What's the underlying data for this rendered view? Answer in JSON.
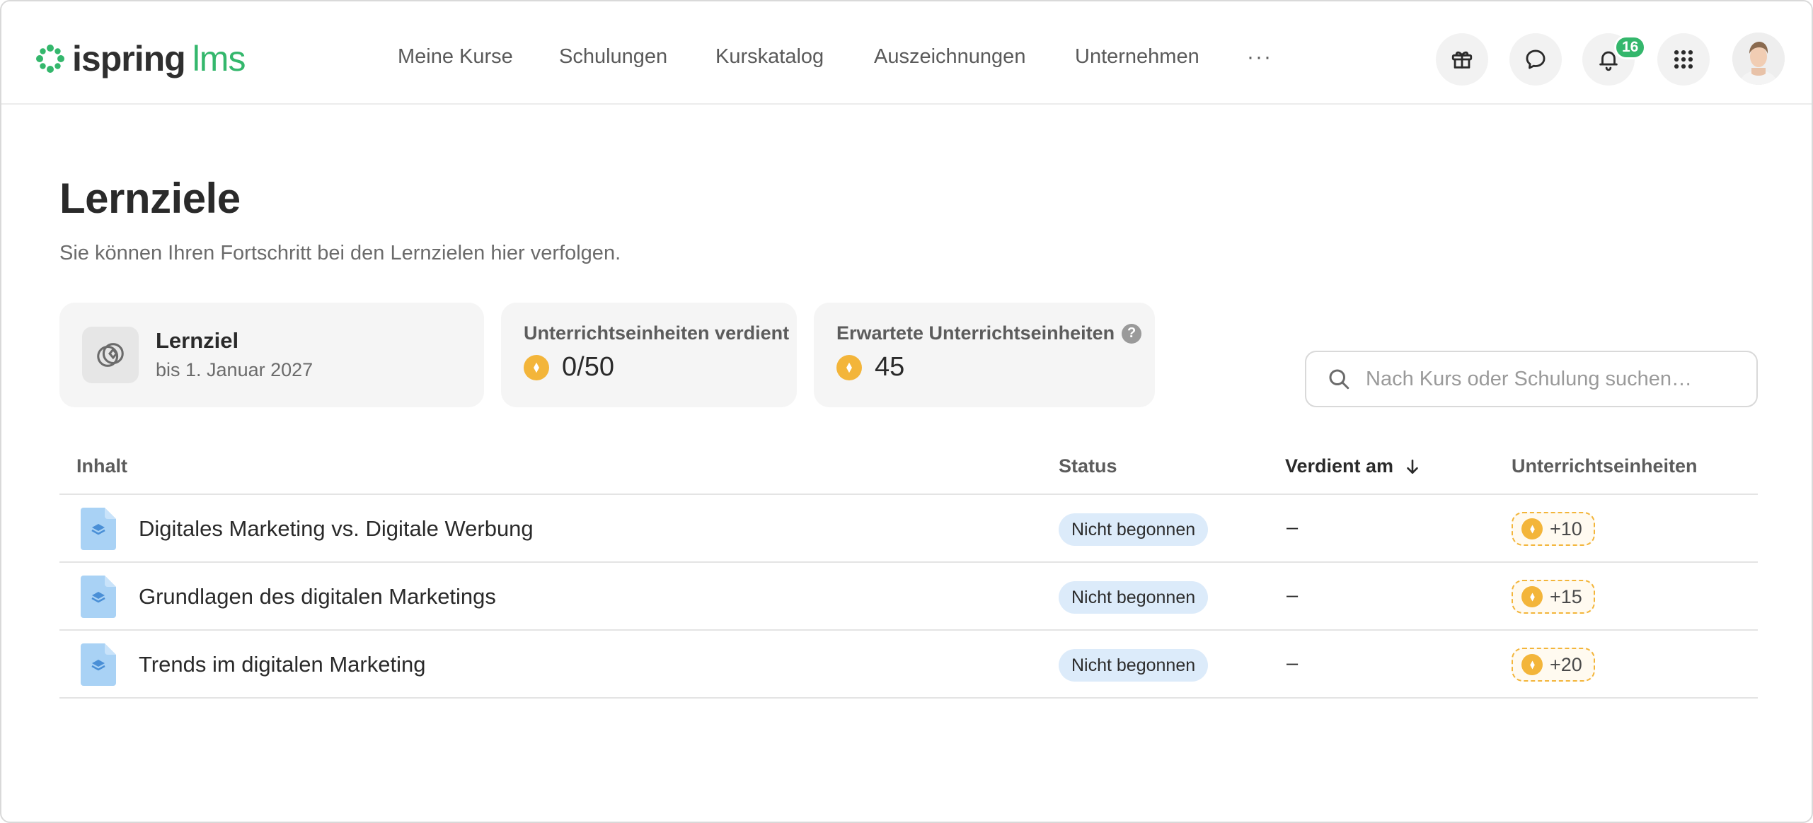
{
  "app": {
    "logo_word1": "ispring",
    "logo_word2": "lms",
    "brand_color": "#34b76c"
  },
  "nav": {
    "items": [
      {
        "label": "Meine Kurse"
      },
      {
        "label": "Schulungen"
      },
      {
        "label": "Kurskatalog"
      },
      {
        "label": "Auszeichnungen"
      },
      {
        "label": "Unternehmen"
      }
    ],
    "more_label": "···"
  },
  "header_actions": {
    "icons": [
      "gift-icon",
      "chat-icon",
      "bell-icon",
      "apps-grid-icon"
    ],
    "notification_count": "16"
  },
  "page": {
    "title": "Lernziele",
    "subtitle": "Sie können Ihren Fortschritt bei den Lernzielen hier verfolgen."
  },
  "summary": {
    "goal": {
      "title": "Lernziel",
      "date": "bis 1. Januar 2027"
    },
    "earned": {
      "label": "Unterrichtseinheiten verdient",
      "value": "0/50"
    },
    "expected": {
      "label": "Erwartete Unterrichtseinheiten",
      "help": "?",
      "value": "45"
    },
    "coin_color": "#f3b53a"
  },
  "search": {
    "placeholder": "Nach Kurs oder Schulung suchen…",
    "value": ""
  },
  "table": {
    "columns": {
      "content": "Inhalt",
      "status": "Status",
      "earned_on": "Verdient am",
      "units": "Unterrichtseinheiten"
    },
    "sort": {
      "column": "earned_on",
      "direction": "descending"
    },
    "rows": [
      {
        "title": "Digitales Marketing vs. Digitale Werbung",
        "status": "Nicht begonnen",
        "earned_on": "–",
        "units": "+10"
      },
      {
        "title": "Grundlagen des digitalen Marketings",
        "status": "Nicht begonnen",
        "earned_on": "–",
        "units": "+15"
      },
      {
        "title": "Trends im digitalen Marketing",
        "status": "Nicht begonnen",
        "earned_on": "–",
        "units": "+20"
      }
    ]
  }
}
